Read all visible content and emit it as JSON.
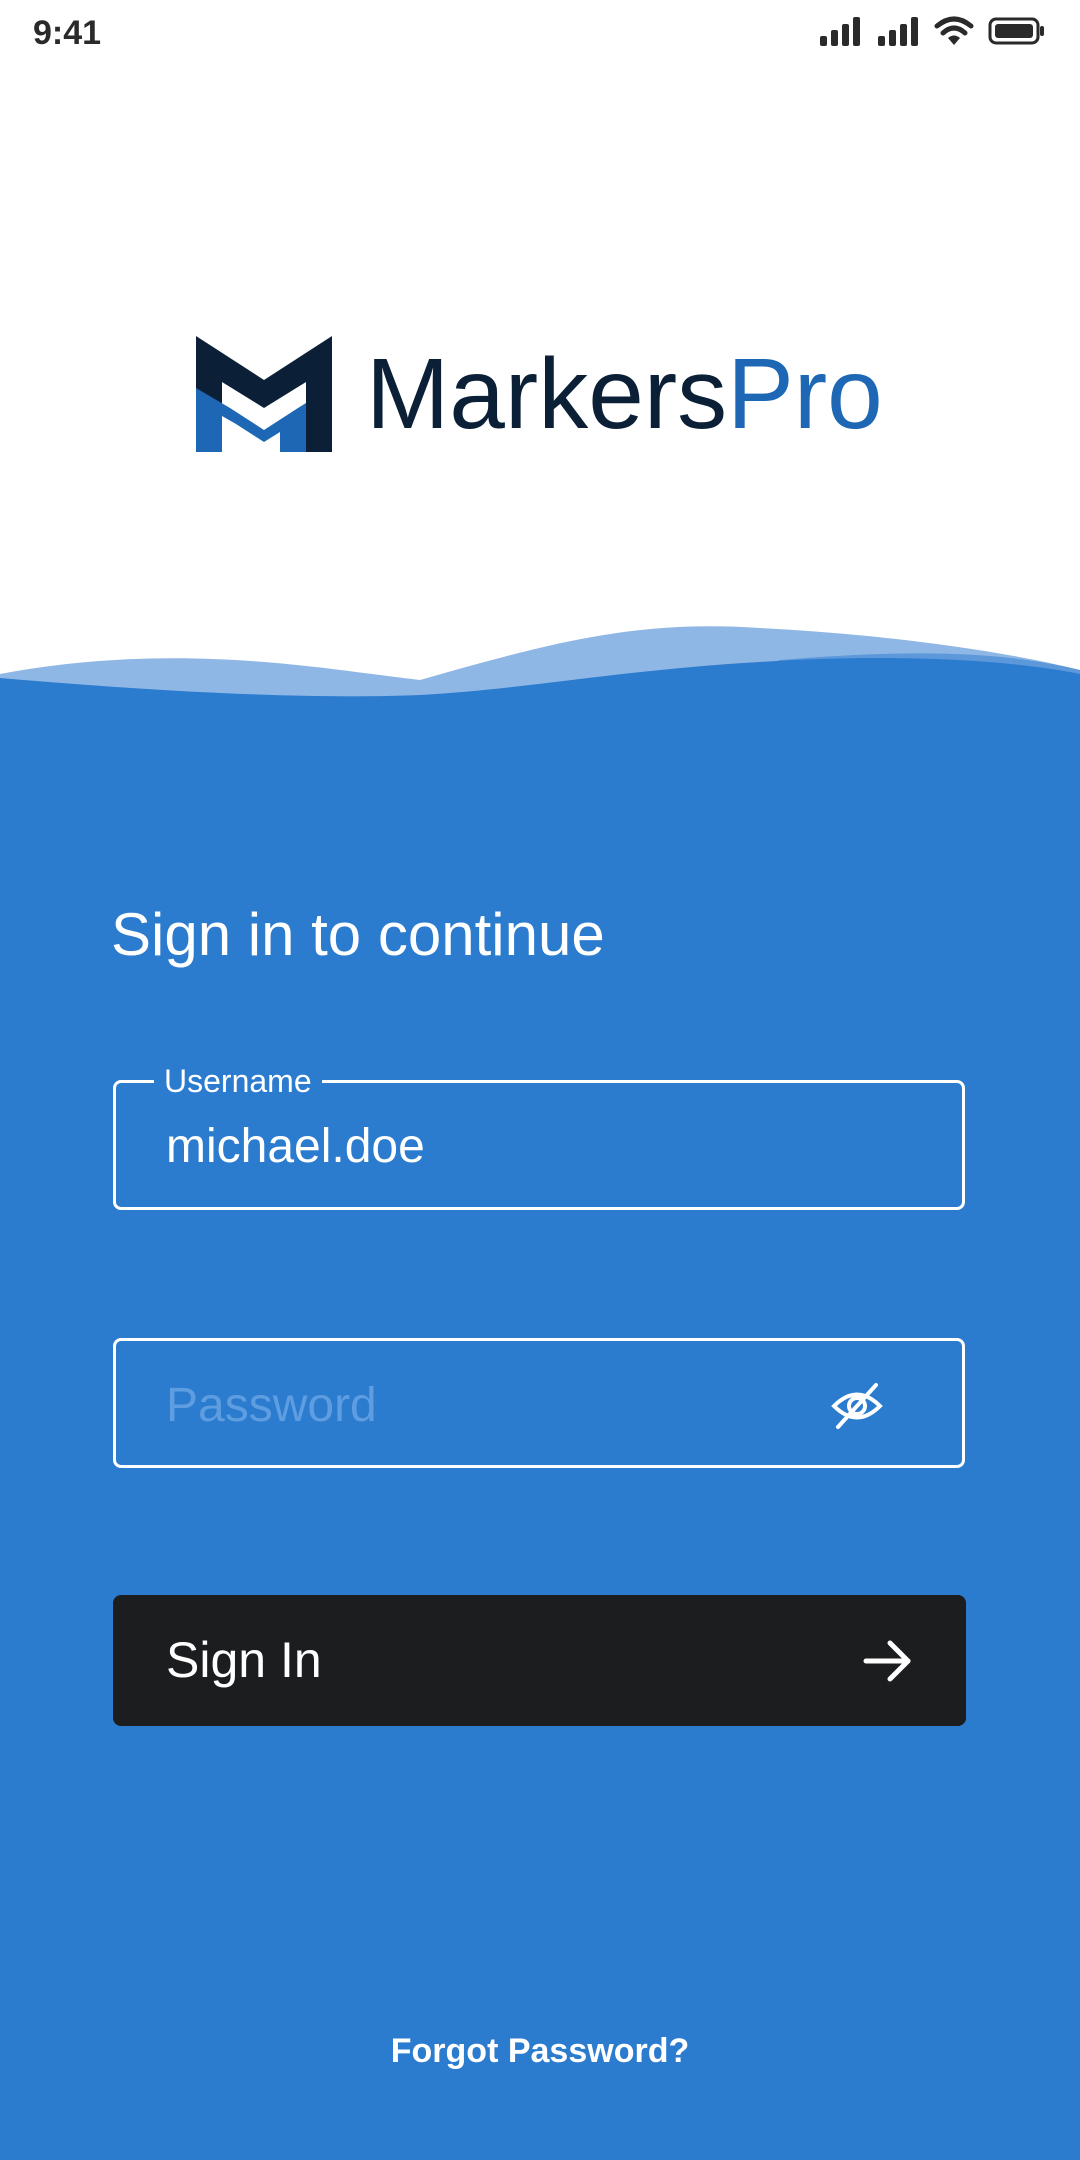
{
  "status_bar": {
    "time": "9:41",
    "icons": [
      "signal-icon",
      "signal-icon",
      "wifi-icon",
      "battery-icon"
    ]
  },
  "logo": {
    "brand_dark": "Markers",
    "brand_blue": "Pro",
    "icon": "markerspro-logo-icon"
  },
  "form": {
    "heading": "Sign in to continue",
    "username": {
      "label": "Username",
      "value": "michael.doe"
    },
    "password": {
      "placeholder": "Password",
      "toggle_icon": "eye-off-icon"
    },
    "submit": {
      "label": "Sign In",
      "icon": "arrow-right-icon"
    },
    "forgot_link": "Forgot Password?"
  },
  "colors": {
    "background_blue": "#2B7BCF",
    "brand_dark": "#0B2037",
    "brand_blue": "#1E67B4",
    "button_dark": "#1C1D1F",
    "wave_light": "#8FB7E5",
    "wave_mid": "#5C98DA"
  }
}
